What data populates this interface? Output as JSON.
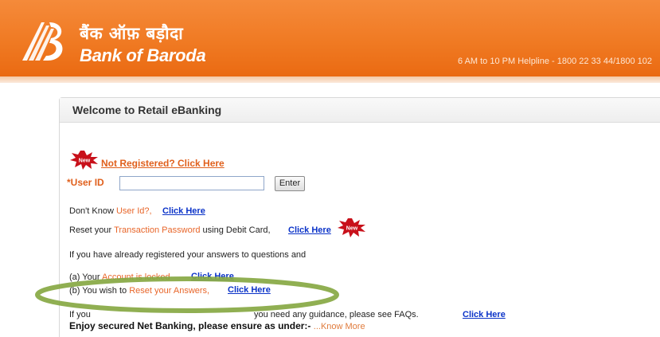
{
  "header": {
    "brand_hindi": "बैंक ऑफ़ बड़ौदा",
    "brand_english": "Bank of Baroda",
    "helpline": "6 AM to 10 PM Helpline - 1800 22 33 44/1800 102",
    "colors": {
      "orange": "#f07a23",
      "white": "#ffffff"
    },
    "logo_icon": "bank-of-baroda-logo"
  },
  "panel": {
    "title": "Welcome to Retail eBanking",
    "new_badge_text": "New",
    "not_registered_link": "Not Registered? Click Here",
    "userid_label": "*User ID",
    "userid_value": "",
    "enter_button": "Enter",
    "dont_know_prefix": "Don't Know ",
    "dont_know_highlight": "User Id?,",
    "dont_know_link": "Click Here",
    "reset_prefix": "Reset your ",
    "reset_highlight": "Transaction Password",
    "reset_suffix": " using Debit Card,",
    "reset_link": "Click Here",
    "registered_line": "If you have already registered your answers to questions and",
    "item_a_prefix": "(a) Your ",
    "item_a_highlight": "Account is locked",
    "item_a_link": "Click Here",
    "item_b_prefix": "(b) You wish to ",
    "item_b_highlight": "Reset your Answers,",
    "item_b_link": "Click Here",
    "faq_prefix": "If you",
    "faq_text": "you need any guidance, please see FAQs.",
    "faq_link": "Click Here",
    "secure_text": "Enjoy secured Net Banking, please ensure as under:-",
    "know_more": "...Know More"
  }
}
